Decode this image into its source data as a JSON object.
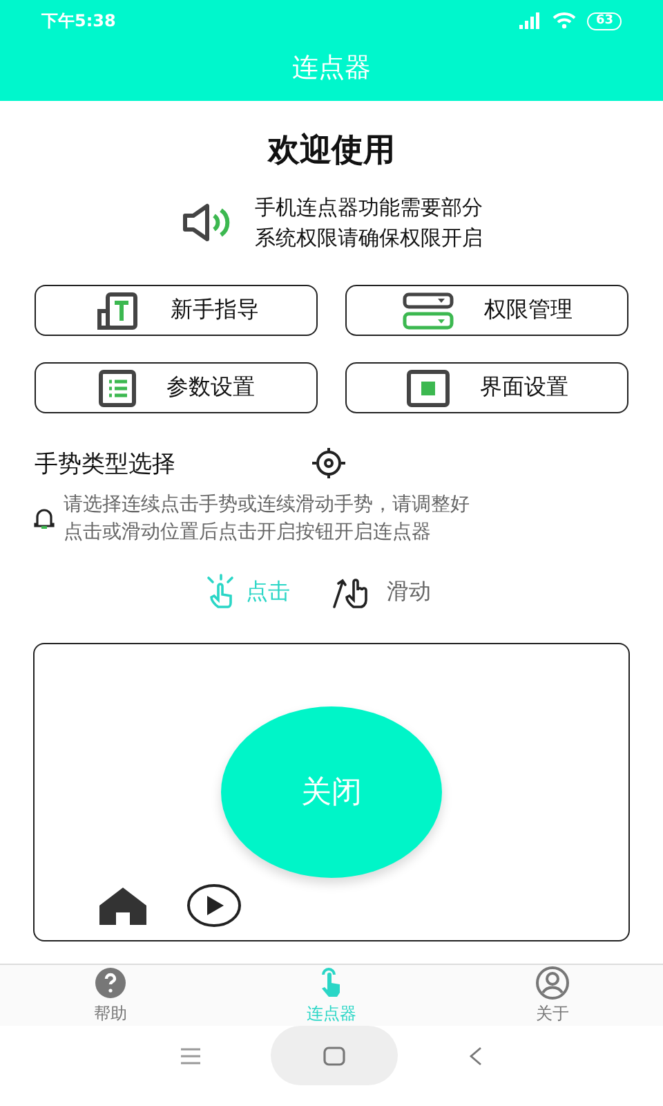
{
  "status_bar": {
    "time": "下午5:38",
    "battery": "63"
  },
  "header": {
    "title": "连点器"
  },
  "welcome": {
    "title": "欢迎使用",
    "message_lines": [
      "手机连点器功能需要部分",
      "系统权限请确保权限开启"
    ]
  },
  "menu_buttons": [
    {
      "label": "新手指导",
      "kind": "guide"
    },
    {
      "label": "权限管理",
      "kind": "permissions"
    },
    {
      "label": "参数设置",
      "kind": "params"
    },
    {
      "label": "界面设置",
      "kind": "ui"
    }
  ],
  "gesture": {
    "title": "手势类型选择",
    "hint_lines": [
      "请选择连续点击手势或连续滑动手势，请调整好",
      "点击或滑动位置后点击开启按钮开启连点器"
    ],
    "options": [
      {
        "label": "点击",
        "kind": "tap",
        "selected": true
      },
      {
        "label": "滑动",
        "kind": "swipe",
        "selected": false
      }
    ]
  },
  "panel": {
    "toggle_label": "关闭"
  },
  "bottom_tabs": [
    {
      "label": "帮助",
      "kind": "help",
      "selected": false
    },
    {
      "label": "连点器",
      "kind": "clicker",
      "selected": true
    },
    {
      "label": "关于",
      "kind": "about",
      "selected": false
    }
  ]
}
